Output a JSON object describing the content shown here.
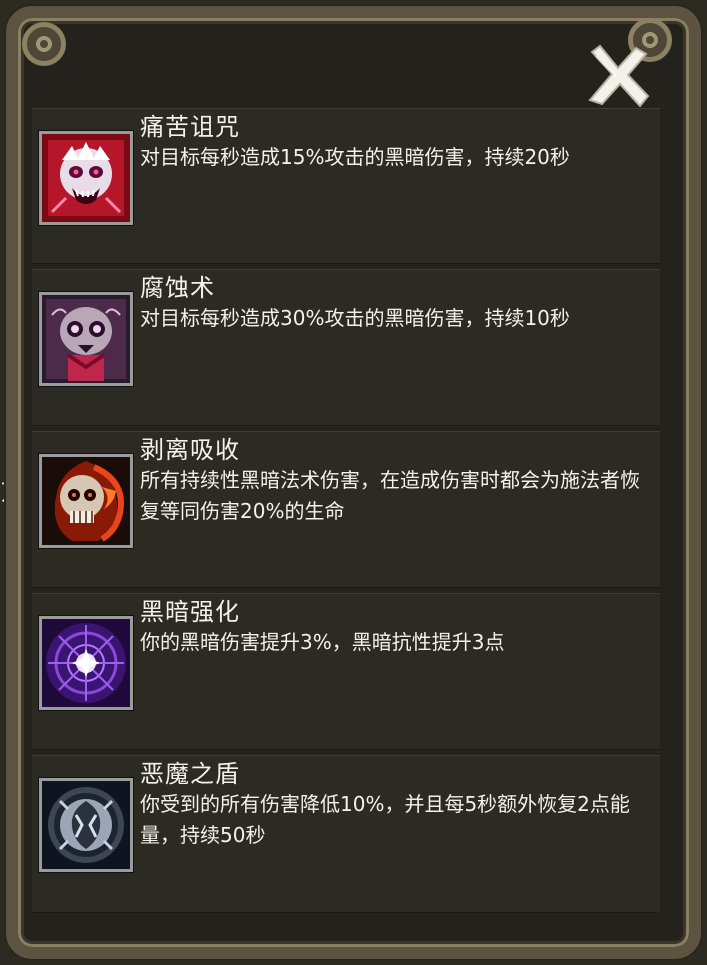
{
  "panel": {
    "close_icon": "close-x-icon",
    "skills": [
      {
        "name": "痛苦诅咒",
        "description": "对目标每秒造成15%攻击的黑暗伤害，持续20秒",
        "icon": "screaming-skull-icon"
      },
      {
        "name": "腐蚀术",
        "description": "对目标每秒造成30%攻击的黑暗伤害，持续10秒",
        "icon": "corrupted-skull-icon"
      },
      {
        "name": "剥离吸收",
        "description": "所有持续性黑暗法术伤害，在造成伤害时都会为施法者恢复等同伤害20%的生命",
        "icon": "flaming-skull-icon"
      },
      {
        "name": "黑暗强化",
        "description": "你的黑暗伤害提升3%，黑暗抗性提升3点",
        "icon": "dark-vortex-icon"
      },
      {
        "name": "恶魔之盾",
        "description": "你受到的所有伤害降低10%，并且每5秒额外恢复2点能量，持续50秒",
        "icon": "demon-shield-icon"
      }
    ]
  },
  "background": {
    "partial_glyph": "东"
  }
}
